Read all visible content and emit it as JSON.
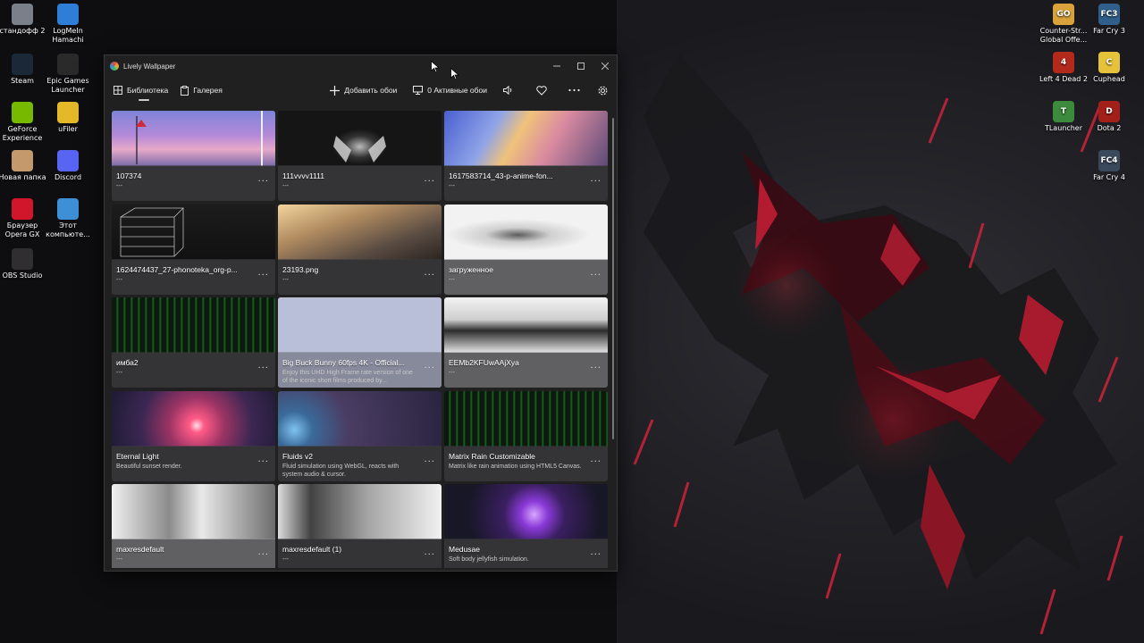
{
  "colors": {
    "window_bg": "#202020",
    "accent_red": "#d0233a",
    "selected_card": "#9ea3b6"
  },
  "desktop": {
    "left_icons": [
      {
        "name": "standoff",
        "label": "стандофф 2",
        "icon": "recycle-bin-icon",
        "color": "#7a7f8a"
      },
      {
        "name": "logmein",
        "label": "LogMeIn Hamachi",
        "icon": "hamachi-icon",
        "color": "#2e7dd6"
      },
      {
        "name": "steam",
        "label": "Steam",
        "icon": "steam-icon",
        "color": "#1b2838"
      },
      {
        "name": "epic",
        "label": "Epic Games Launcher",
        "icon": "epic-icon",
        "color": "#2a2a2a"
      },
      {
        "name": "geforce",
        "label": "GeForce Experience",
        "icon": "nvidia-icon",
        "color": "#76b900"
      },
      {
        "name": "ufiler",
        "label": "uFiler",
        "icon": "folder-icon",
        "color": "#e3b92a"
      },
      {
        "name": "new-folder",
        "label": "Новая папка",
        "icon": "folder-icon",
        "color": "#c49a6c"
      },
      {
        "name": "discord",
        "label": "Discord",
        "icon": "discord-icon",
        "color": "#5865f2"
      },
      {
        "name": "opera",
        "label": "Браузер Opera GX",
        "icon": "opera-icon",
        "color": "#d1152b"
      },
      {
        "name": "this-pc",
        "label": "Этот компьюте...",
        "icon": "computer-icon",
        "color": "#3d8fd6"
      },
      {
        "name": "obs",
        "label": "OBS Studio",
        "icon": "obs-icon",
        "color": "#302e31"
      }
    ],
    "right_icons": [
      {
        "name": "csgo",
        "label": "Counter-Str... Global Offe...",
        "icon": "csgo-icon",
        "color": "#d9a23a",
        "glyph": "GO"
      },
      {
        "name": "farcry3",
        "label": "Far Cry 3",
        "icon": "farcry-icon",
        "color": "#2f5f8a",
        "glyph": "FC3"
      },
      {
        "name": "l4d2",
        "label": "Left 4 Dead 2",
        "icon": "l4d2-icon",
        "color": "#b32a1c",
        "glyph": "4"
      },
      {
        "name": "cuphead",
        "label": "Cuphead",
        "icon": "cuphead-icon",
        "color": "#e6c23a",
        "glyph": "C"
      },
      {
        "name": "tlauncher",
        "label": "TLauncher",
        "icon": "tlauncher-icon",
        "color": "#3c8a3c",
        "glyph": "T"
      },
      {
        "name": "dota2",
        "label": "Dota 2",
        "icon": "dota-icon",
        "color": "#a3201a",
        "glyph": "D"
      },
      {
        "name": "farcry4",
        "label": "Far Cry 4",
        "icon": "farcry-icon",
        "color": "#3a4a5c",
        "glyph": "FC4"
      }
    ]
  },
  "window": {
    "title": "Lively Wallpaper",
    "tabs": [
      {
        "label": "Библиотека",
        "icon": "grid-icon",
        "active": true
      },
      {
        "label": "Галерея",
        "icon": "clipboard-icon",
        "active": false
      }
    ],
    "toolbar": {
      "add_label": "Добавить обои",
      "active_label": "0 Активные обои"
    }
  },
  "cards": [
    {
      "title": "107374",
      "desc": "---",
      "thumb": "sky"
    },
    {
      "title": "111vvvv1111",
      "desc": "---",
      "thumb": "darkmask"
    },
    {
      "title": "1617583714_43-p-anime-fon...",
      "desc": "---",
      "thumb": "anime-town"
    },
    {
      "title": "1624474437_27-phonoteka_org-p...",
      "desc": "---",
      "thumb": "wireframe"
    },
    {
      "title": "23193.png",
      "desc": "---",
      "thumb": "sunset-street"
    },
    {
      "title": "загруженное",
      "desc": "---",
      "thumb": "white-blur",
      "light": true
    },
    {
      "title": "имба2",
      "desc": "---",
      "thumb": "matrix"
    },
    {
      "title": "Big Buck Bunny 60fps 4K - Official...",
      "desc": "Enjoy this UHD High Frame rate version of one of the iconic short films produced by...",
      "thumb": "plain",
      "selected": true
    },
    {
      "title": "EEMb2KFUwAAjXya",
      "desc": "---",
      "thumb": "manga-face",
      "light": true
    },
    {
      "title": "Eternal Light",
      "desc": "Beautiful sunset render.",
      "thumb": "eternal"
    },
    {
      "title": "Fluids v2",
      "desc": "Fluid simulation using WebGL, reacts with system audio & cursor.",
      "thumb": "fluids"
    },
    {
      "title": "Matrix Rain Customizable",
      "desc": "Matrix like rain animation using HTML5 Canvas.",
      "thumb": "matrix"
    },
    {
      "title": "maxresdefault",
      "desc": "---",
      "thumb": "manga-two",
      "light": true
    },
    {
      "title": "maxresdefault (1)",
      "desc": "---",
      "thumb": "manga-ghoul"
    },
    {
      "title": "Medusae",
      "desc": "Soft body jellyfish simulation.",
      "thumb": "medusae"
    }
  ],
  "card_more": "···"
}
